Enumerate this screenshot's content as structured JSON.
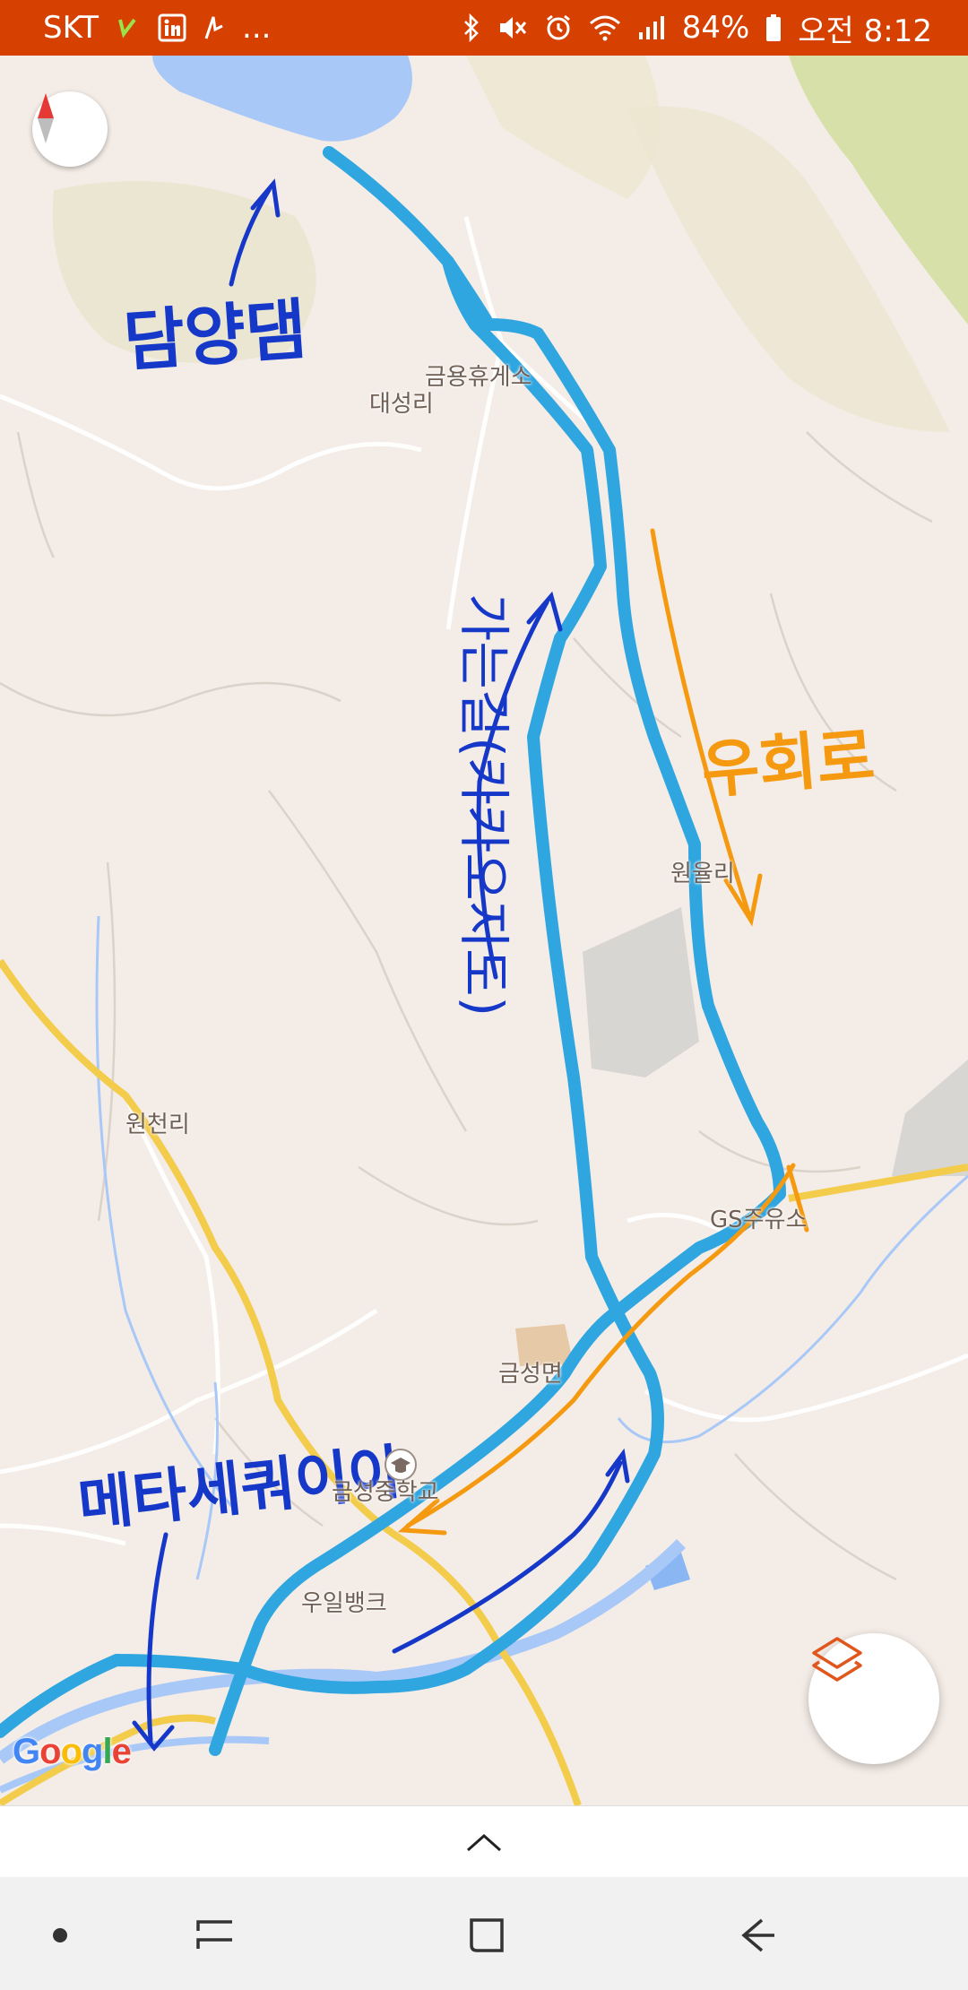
{
  "status_bar": {
    "carrier": "SKT",
    "battery": "84%",
    "time": "오전 8:12",
    "more": "..."
  },
  "map": {
    "place_labels": [
      "금용휴게소",
      "대성리",
      "원율리",
      "원천리",
      "GS주유소",
      "금성면",
      "금성중학교",
      "우일뱅크"
    ],
    "handwritten_notes": [
      "담양댐",
      "가는길(카카오지도)",
      "우회로",
      "메타세쿼이아"
    ],
    "attribution": "Google",
    "colors": {
      "route": "#30a6e0",
      "note_blue": "#1638c8",
      "note_orange": "#f59a10",
      "status_bar": "#d64000",
      "yellow_road": "#f2cc4a",
      "water": "#a8c8f8"
    },
    "icons": [
      "compass-icon",
      "layers-icon",
      "school-icon"
    ]
  },
  "bottom_sheet": {
    "handle_icon": "chevron-up-icon"
  },
  "nav_bar": {
    "icons": [
      "dot-icon",
      "recent-apps-icon",
      "home-icon",
      "back-icon"
    ]
  }
}
